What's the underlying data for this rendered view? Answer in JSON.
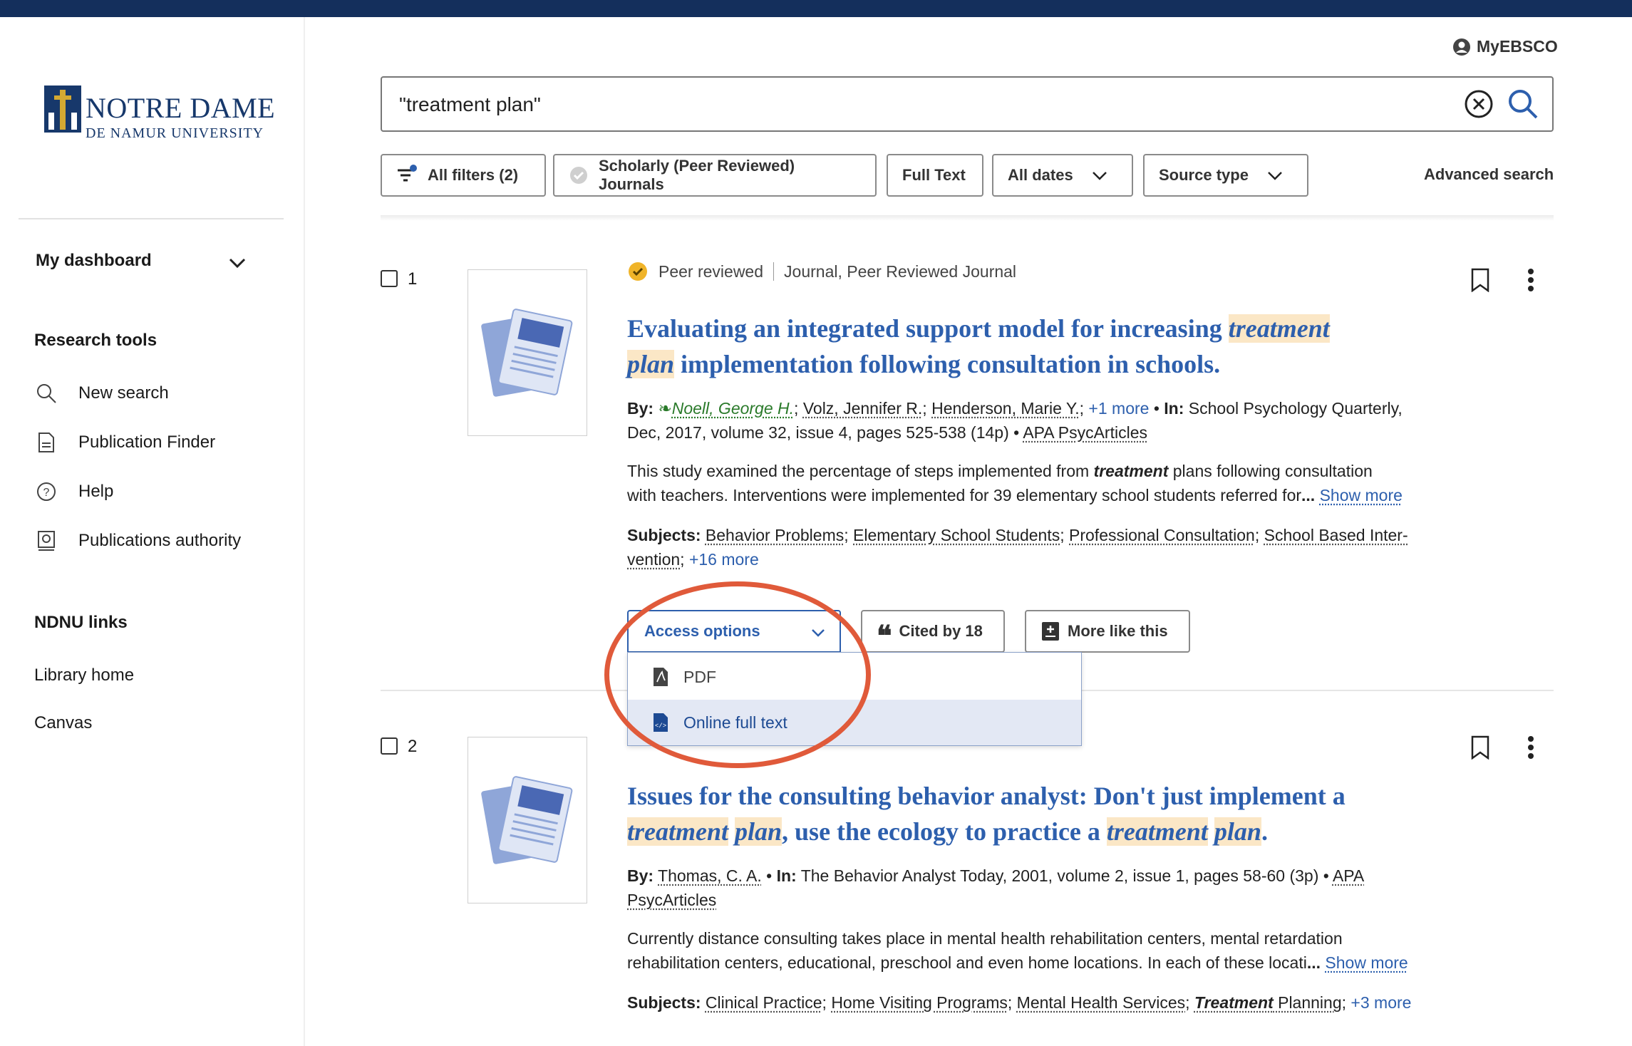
{
  "sidebar": {
    "logo_line1": "NOTRE DAME",
    "logo_line2": "DE NAMUR UNIVERSITY",
    "dashboard_label": "My dashboard",
    "research_tools_title": "Research tools",
    "research_tools": [
      {
        "label": "New search",
        "icon": "search-icon"
      },
      {
        "label": "Publication Finder",
        "icon": "document-icon"
      },
      {
        "label": "Help",
        "icon": "help-icon"
      },
      {
        "label": "Publications authority",
        "icon": "publication-authority-icon"
      }
    ],
    "ndnu_title": "NDNU links",
    "ndnu_links": [
      "Library home",
      "Canvas"
    ]
  },
  "header": {
    "myebsco_label": "MyEBSCO",
    "search_value": "\"treatment plan\"",
    "filters": {
      "all_filters": "All filters (2)",
      "scholarly": "Scholarly (Peer Reviewed) Journals",
      "full_text": "Full Text",
      "all_dates": "All dates",
      "source_type": "Source type"
    },
    "advanced_search": "Advanced search"
  },
  "results": [
    {
      "number": "1",
      "peer_reviewed": "Peer reviewed",
      "source_type": "Journal, Peer Reviewed Journal",
      "title_part1": "Evaluating an integrated support model for increasing ",
      "title_hl1": "treatment",
      "title_hl2": "plan",
      "title_part2": " implementation following consultation in schools.",
      "by_label": "By:",
      "author1": "Noell, George H.",
      "author2": "Volz, Jennifer R.",
      "author3": "Henderson, Marie Y.",
      "more_authors": "+1 more",
      "in_label": "In:",
      "publication": "School Psychology Quarterly,",
      "pub_details": "Dec, 2017, volume 32, issue 4, pages 525-538 (14p)",
      "database": "APA PsycArticles",
      "abstract_pre": "This study examined the percentage of steps implemented from ",
      "abstract_hl": "treatment",
      "abstract_post": " plans following consultation",
      "abstract_line2": "with teachers. Interventions were implemented for 39 elementary school students referred for",
      "ellipsis": "...",
      "show_more": "Show more",
      "subjects_label": "Subjects:",
      "subject1": "Behavior Problems",
      "subject2": "Elementary School Students",
      "subject3": "Professional Consultation",
      "subject4a": "School Based Inter-",
      "subject4b": "vention",
      "more_subjects": "+16 more",
      "access_options": "Access options",
      "cited_by": "Cited by 18",
      "more_like_this": "More like this",
      "dropdown": [
        "PDF",
        "Online full text"
      ]
    },
    {
      "number": "2",
      "title_part1": "Issues for the consulting behavior analyst: Don't just implement a",
      "title_hl1": "treatment",
      "title_hl2": "plan",
      "title_mid": ", use the ecology to practice a ",
      "title_hl3": "treatment",
      "title_hl4": "plan",
      "title_end": ".",
      "by_label": "By:",
      "author1": "Thomas, C. A.",
      "in_label": "In:",
      "publication": "The Behavior Analyst Today, 2001, volume 2, issue 1, pages 58-60 (3p)",
      "database_a": "APA",
      "database_b": "PsycArticles",
      "abstract_line1": "Currently distance consulting takes place in mental health rehabilitation centers, mental retardation",
      "abstract_line2": "rehabilitation centers, educational, preschool and even home locations. In each of these locati",
      "ellipsis": "...",
      "show_more": "Show more",
      "subjects_label": "Subjects:",
      "subject1": "Clinical Practice",
      "subject2": "Home Visiting Programs",
      "subject3": "Mental Health Services",
      "subject4_hl": "Treatment",
      "subject4_rest": " Planning",
      "more_subjects": "+3 more"
    }
  ],
  "colors": {
    "topbar": "#142f5c",
    "link_blue": "#2d5fad",
    "highlight": "#fbe7c6",
    "annotation_red": "#e05a3a",
    "peer_badge": "#f0b429"
  }
}
